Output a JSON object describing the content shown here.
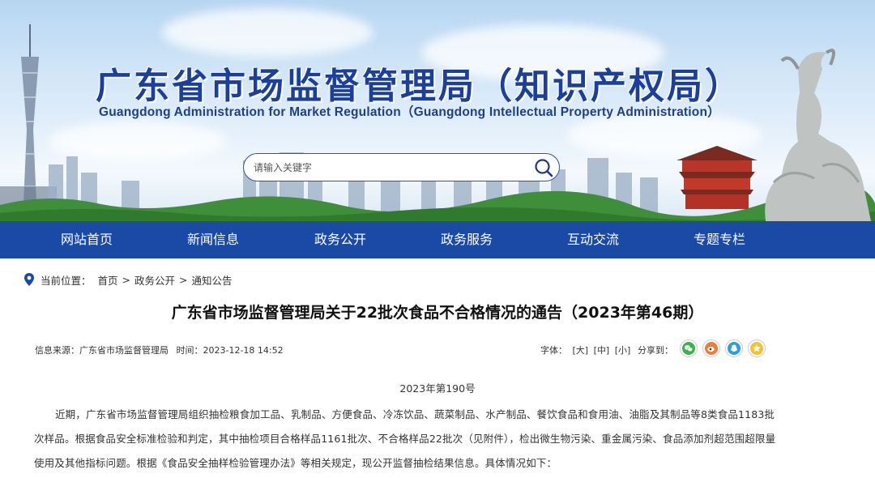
{
  "header": {
    "title_cn": "广东省市场监督管理局（知识产权局）",
    "title_en": "Guangdong Administration for Market Regulation（Guangdong Intellectual Property Administration）",
    "search": {
      "placeholder": "请输入关键字",
      "icon": "search-icon"
    }
  },
  "nav": {
    "items": [
      "网站首页",
      "新闻信息",
      "政务公开",
      "政务服务",
      "互动交流",
      "专题专栏"
    ],
    "background": "#1b4aa6"
  },
  "breadcrumb": {
    "label": "当前位置：",
    "items": [
      "首页",
      "政务公开",
      "通知公告"
    ],
    "separator": ">"
  },
  "article": {
    "title": "广东省市场监督管理局关于22批次食品不合格情况的通告（2023年第46期）",
    "source": "信息来源：广东省市场监督管理局",
    "time": "时间：2023-12-18 14:52",
    "font_label": "字体：",
    "font_sizes": [
      "[大]",
      "[中]",
      "[小]"
    ],
    "share_label": "分享到：",
    "share_icons": [
      "wechat-icon",
      "weibo-icon",
      "qq-icon",
      "qzone-icon"
    ],
    "doc_number": "2023年第190号",
    "body": "近期，广东省市场监督管理局组织抽检粮食加工品、乳制品、方便食品、冷冻饮品、蔬菜制品、水产制品、餐饮食品和食用油、油脂及其制品等8类食品1183批次样品。根据食品安全标准检验和判定，其中抽检项目合格样品1161批次、不合格样品22批次（见附件），检出微生物污染、重金属污染、食品添加剂超范围超限量使用及其他指标问题。根据《食品安全抽样检验管理办法》等相关规定，现公开监督抽检结果信息。具体情况如下："
  }
}
